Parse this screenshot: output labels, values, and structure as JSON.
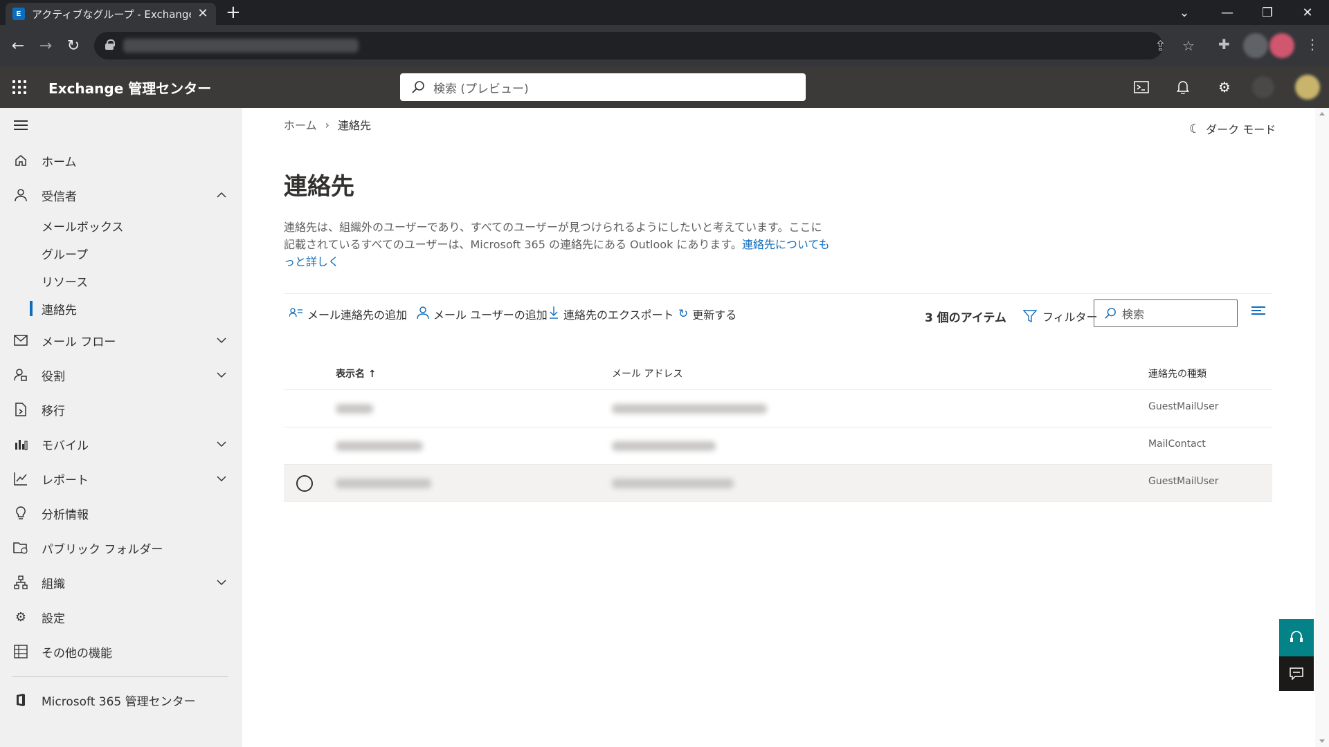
{
  "browser": {
    "tab_title": "アクティブなグループ - Exchange adm",
    "favicon_label": "E"
  },
  "header": {
    "app_name": "Exchange 管理センター",
    "search_placeholder": "検索 (プレビュー)"
  },
  "sidebar": {
    "items": [
      {
        "label": "ホーム",
        "icon": "home-icon"
      },
      {
        "label": "受信者",
        "icon": "person-icon",
        "expanded": true
      },
      {
        "label": "メールボックス"
      },
      {
        "label": "グループ"
      },
      {
        "label": "リソース"
      },
      {
        "label": "連絡先",
        "selected": true
      },
      {
        "label": "メール フロー",
        "icon": "mail-icon"
      },
      {
        "label": "役割",
        "icon": "roles-icon"
      },
      {
        "label": "移行",
        "icon": "migration-icon"
      },
      {
        "label": "モバイル",
        "icon": "mobile-icon"
      },
      {
        "label": "レポート",
        "icon": "chart-icon"
      },
      {
        "label": "分析情報",
        "icon": "lightbulb-icon"
      },
      {
        "label": "パブリック フォルダー",
        "icon": "folder-icon"
      },
      {
        "label": "組織",
        "icon": "org-icon"
      },
      {
        "label": "設定",
        "icon": "gear-icon"
      },
      {
        "label": "その他の機能",
        "icon": "table-icon"
      },
      {
        "label": "Microsoft 365 管理センター",
        "icon": "office-icon"
      }
    ]
  },
  "main": {
    "breadcrumb": {
      "home": "ホーム",
      "current": "連絡先"
    },
    "dark_mode_label": "ダーク モード",
    "title": "連絡先",
    "description": "連絡先は、組織外のユーザーであり、すべてのユーザーが見つけられるようにしたいと考えています。ここに記載されているすべてのユーザーは、Microsoft 365 の連絡先にある Outlook にあります。",
    "learn_more_link": "連絡先についてもっと詳しく",
    "commands": {
      "add_mail_contact": "メール連絡先の追加",
      "add_mail_user": "メール ユーザーの追加",
      "export": "連絡先のエクスポート",
      "refresh": "更新する"
    },
    "item_count": "3 個のアイテム",
    "filter_label": "フィルター",
    "list_search_placeholder": "検索",
    "table": {
      "columns": [
        "表示名",
        "メール アドレス",
        "連絡先の種類"
      ],
      "sort_indicator": "↑",
      "rows": [
        {
          "type": "GuestMailUser"
        },
        {
          "type": "MailContact"
        },
        {
          "type": "GuestMailUser"
        }
      ]
    }
  },
  "colors": {
    "accent": "#0f6cbd",
    "header_bg": "#3b3a39",
    "sidebar_bg": "#f0f0f0",
    "help_bg": "#038387"
  }
}
